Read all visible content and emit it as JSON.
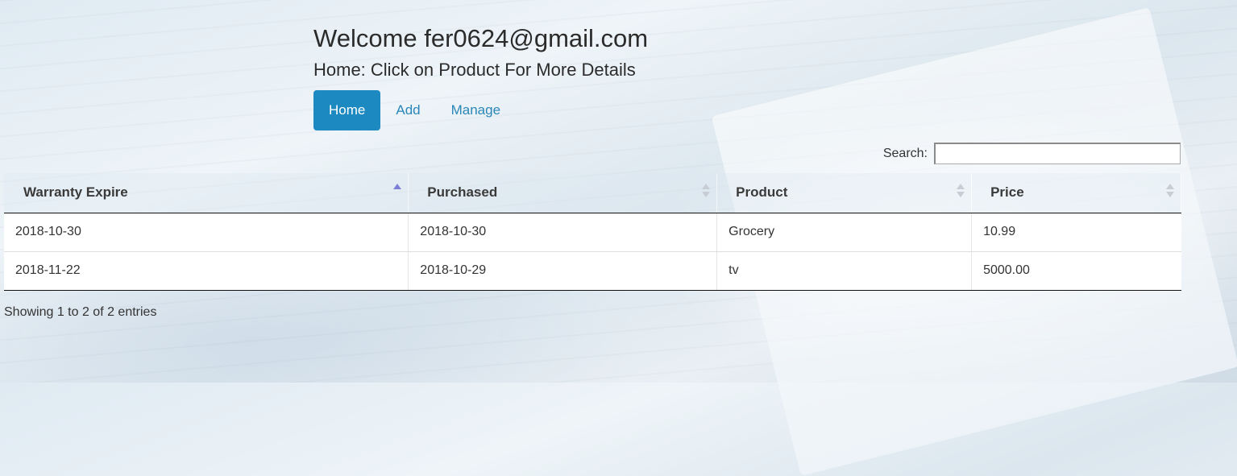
{
  "header": {
    "welcome": "Welcome fer0624@gmail.com",
    "subtitle": "Home: Click on Product For More Details"
  },
  "nav": {
    "items": [
      {
        "label": "Home",
        "active": true
      },
      {
        "label": "Add",
        "active": false
      },
      {
        "label": "Manage",
        "active": false
      }
    ]
  },
  "search": {
    "label": "Search:",
    "value": ""
  },
  "table": {
    "columns": [
      {
        "label": "Warranty Expire",
        "sort": "asc"
      },
      {
        "label": "Purchased",
        "sort": "none"
      },
      {
        "label": "Product",
        "sort": "none"
      },
      {
        "label": "Price",
        "sort": "none"
      }
    ],
    "rows": [
      [
        "2018-10-30",
        "2018-10-30",
        "Grocery",
        "10.99"
      ],
      [
        "2018-11-22",
        "2018-10-29",
        "tv",
        "5000.00"
      ]
    ]
  },
  "info": "Showing 1 to 2 of 2 entries",
  "colors": {
    "accent": "#1c8ac1",
    "link": "#2a86b8",
    "sort_active": "#7b7fd6"
  }
}
